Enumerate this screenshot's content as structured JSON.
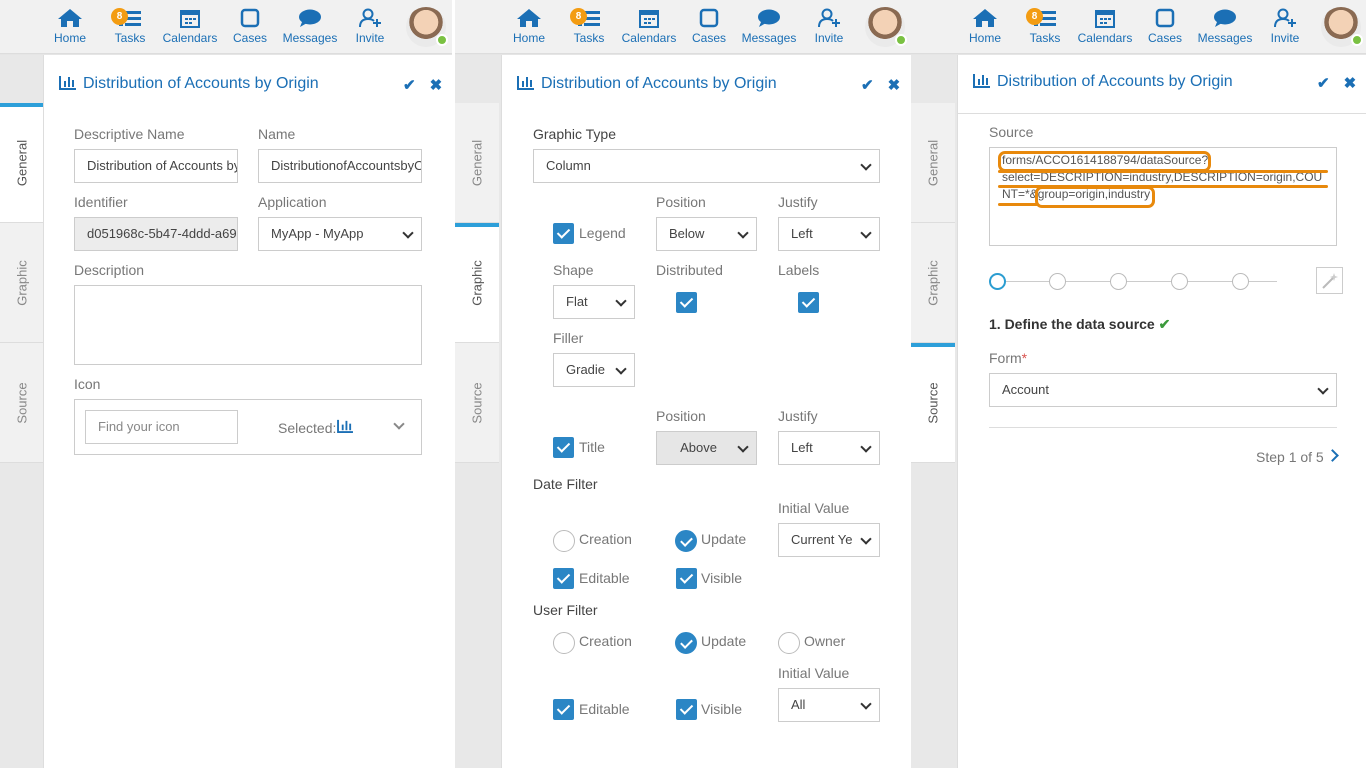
{
  "nav": {
    "items": [
      {
        "label": "Home",
        "icon": "home-icon"
      },
      {
        "label": "Tasks",
        "icon": "tasks-icon",
        "badge": "8"
      },
      {
        "label": "Calendars",
        "icon": "calendar-icon"
      },
      {
        "label": "Cases",
        "icon": "cases-icon"
      },
      {
        "label": "Messages",
        "icon": "messages-icon"
      },
      {
        "label": "Invite",
        "icon": "invite-icon"
      }
    ],
    "badge_color": "#f39c12",
    "accent": "#1b6fb5",
    "online_color": "#7ac142"
  },
  "side_tabs": {
    "general": "General",
    "graphic": "Graphic",
    "source": "Source"
  },
  "panel_title": "Distribution of Accounts by Origin",
  "general": {
    "descriptive_name_label": "Descriptive Name",
    "descriptive_name_value": "Distribution of Accounts by",
    "name_label": "Name",
    "name_value": "DistributionofAccountsbyO",
    "identifier_label": "Identifier",
    "identifier_value": "d051968c-5b47-4ddd-a69",
    "application_label": "Application",
    "application_value": "MyApp - MyApp",
    "description_label": "Description",
    "icon_label": "Icon",
    "icon_placeholder": "Find your icon",
    "icon_selected_label": "Selected:"
  },
  "graphic": {
    "graphic_type_label": "Graphic Type",
    "graphic_type_value": "Column",
    "position_label": "Position",
    "justify_label": "Justify",
    "legend_label": "Legend",
    "legend_position": "Below",
    "legend_justify": "Left",
    "shape_label": "Shape",
    "shape_value": "Flat",
    "distributed_label": "Distributed",
    "labels_label": "Labels",
    "filler_label": "Filler",
    "filler_value": "Gradie",
    "title_label": "Title",
    "title_position": "Above",
    "title_justify": "Left",
    "date_filter_label": "Date Filter",
    "initial_value_label": "Initial Value",
    "date_initial_value": "Current Ye",
    "creation_label": "Creation",
    "update_label": "Update",
    "editable_label": "Editable",
    "visible_label": "Visible",
    "user_filter_label": "User Filter",
    "owner_label": "Owner",
    "user_initial_value": "All"
  },
  "source": {
    "source_label": "Source",
    "source_line1": "forms/ACCO1614188794/dataSource?",
    "source_line2": "select=DESCRIPTION=industry,DESCRIPTION=origin,COU",
    "source_line3a": "NT=*&",
    "source_line3b": "group=origin,industry",
    "step_title": "1. Define the data source",
    "form_label": "Form",
    "form_required": "*",
    "form_value": "Account",
    "step_indicator": "Step 1 of 5",
    "highlight_color": "#e8890c",
    "check_color": "#3c9a3c"
  }
}
